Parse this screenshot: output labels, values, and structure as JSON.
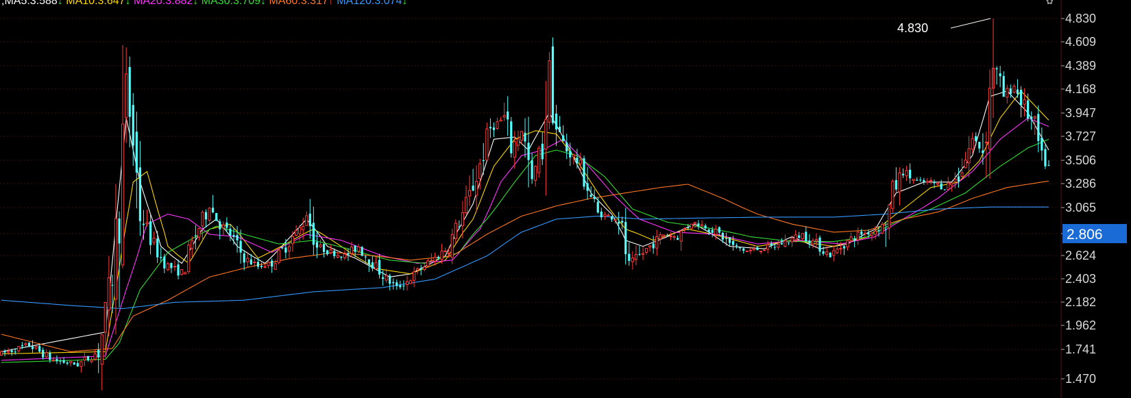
{
  "chart_data": {
    "type": "candlestick",
    "legend": [
      {
        "text": ",MA5:3.588",
        "color": "#ffffff",
        "arrow": "↓"
      },
      {
        "text": "MA10:3.647",
        "color": "#ffd700",
        "arrow": "↓"
      },
      {
        "text": "MA20:3.882",
        "color": "#ff33ff",
        "arrow": "↓"
      },
      {
        "text": "MA30:3.709",
        "color": "#33dd33",
        "arrow": "↓"
      },
      {
        "text": "MA60:3.317",
        "color": "#ff7722",
        "arrow": "↑"
      },
      {
        "text": "MA120:3.074",
        "color": "#3399ff",
        "arrow": "↓"
      }
    ],
    "y_ticks": [
      "4.830",
      "4.609",
      "4.389",
      "4.168",
      "3.947",
      "3.727",
      "3.506",
      "3.286",
      "3.065",
      "2.806",
      "2.624",
      "2.403",
      "2.182",
      "1.962",
      "1.741",
      "1.470"
    ],
    "ylim": [
      1.43,
      4.9
    ],
    "current_price": "2.806",
    "max_label": "4.830",
    "colors": {
      "up": "#ff3b3b",
      "down": "#54ffff",
      "grid": "#3a1010",
      "highlight": "#1a6bd6"
    },
    "anchors": [
      [
        0,
        1.7
      ],
      [
        8,
        1.78
      ],
      [
        15,
        1.64
      ],
      [
        22,
        1.6
      ],
      [
        28,
        1.72
      ],
      [
        31,
        2.2
      ],
      [
        34,
        3.1
      ],
      [
        36,
        4.2
      ],
      [
        38,
        3.7
      ],
      [
        40,
        3.0
      ],
      [
        44,
        2.7
      ],
      [
        47,
        2.55
      ],
      [
        52,
        2.45
      ],
      [
        56,
        2.8
      ],
      [
        60,
        3.08
      ],
      [
        63,
        2.9
      ],
      [
        66,
        2.8
      ],
      [
        70,
        2.6
      ],
      [
        74,
        2.52
      ],
      [
        78,
        2.55
      ],
      [
        82,
        2.7
      ],
      [
        86,
        2.85
      ],
      [
        88,
        3.0
      ],
      [
        91,
        2.7
      ],
      [
        95,
        2.65
      ],
      [
        99,
        2.62
      ],
      [
        103,
        2.7
      ],
      [
        107,
        2.55
      ],
      [
        111,
        2.4
      ],
      [
        114,
        2.32
      ],
      [
        117,
        2.38
      ],
      [
        121,
        2.5
      ],
      [
        125,
        2.6
      ],
      [
        129,
        2.7
      ],
      [
        133,
        3.0
      ],
      [
        137,
        3.35
      ],
      [
        141,
        3.8
      ],
      [
        145,
        3.9
      ],
      [
        147,
        3.6
      ],
      [
        150,
        3.8
      ],
      [
        153,
        3.3
      ],
      [
        156,
        3.65
      ],
      [
        158,
        4.4
      ],
      [
        160,
        3.8
      ],
      [
        163,
        3.6
      ],
      [
        166,
        3.5
      ],
      [
        169,
        3.25
      ],
      [
        172,
        3.0
      ],
      [
        175,
        2.98
      ],
      [
        178,
        2.95
      ],
      [
        181,
        2.52
      ],
      [
        184,
        2.62
      ],
      [
        187,
        2.7
      ],
      [
        191,
        2.8
      ],
      [
        195,
        2.78
      ],
      [
        199,
        2.92
      ],
      [
        203,
        2.88
      ],
      [
        207,
        2.8
      ],
      [
        211,
        2.7
      ],
      [
        215,
        2.66
      ],
      [
        219,
        2.68
      ],
      [
        223,
        2.7
      ],
      [
        227,
        2.75
      ],
      [
        231,
        2.8
      ],
      [
        235,
        2.72
      ],
      [
        239,
        2.62
      ],
      [
        243,
        2.72
      ],
      [
        247,
        2.8
      ],
      [
        251,
        2.82
      ],
      [
        255,
        2.9
      ],
      [
        257,
        3.2
      ],
      [
        260,
        3.4
      ],
      [
        264,
        3.3
      ],
      [
        268,
        3.3
      ],
      [
        272,
        3.25
      ],
      [
        276,
        3.35
      ],
      [
        280,
        3.7
      ],
      [
        283,
        3.6
      ],
      [
        286,
        4.4
      ],
      [
        289,
        4.1
      ],
      [
        292,
        4.2
      ],
      [
        295,
        4.0
      ],
      [
        298,
        3.8
      ],
      [
        300,
        3.5
      ],
      [
        302,
        3.45
      ]
    ],
    "ma": {
      "MA5": [
        [
          0,
          1.72
        ],
        [
          30,
          1.9
        ],
        [
          36,
          3.9
        ],
        [
          40,
          3.3
        ],
        [
          46,
          2.7
        ],
        [
          52,
          2.55
        ],
        [
          58,
          2.85
        ],
        [
          62,
          2.95
        ],
        [
          68,
          2.7
        ],
        [
          76,
          2.55
        ],
        [
          84,
          2.8
        ],
        [
          88,
          2.95
        ],
        [
          94,
          2.7
        ],
        [
          102,
          2.6
        ],
        [
          112,
          2.42
        ],
        [
          118,
          2.45
        ],
        [
          128,
          2.62
        ],
        [
          136,
          3.1
        ],
        [
          142,
          3.7
        ],
        [
          148,
          3.72
        ],
        [
          152,
          3.6
        ],
        [
          158,
          3.95
        ],
        [
          164,
          3.6
        ],
        [
          170,
          3.2
        ],
        [
          176,
          3.0
        ],
        [
          180,
          2.75
        ],
        [
          185,
          2.7
        ],
        [
          192,
          2.78
        ],
        [
          200,
          2.9
        ],
        [
          210,
          2.7
        ],
        [
          220,
          2.68
        ],
        [
          228,
          2.78
        ],
        [
          236,
          2.68
        ],
        [
          244,
          2.72
        ],
        [
          252,
          2.85
        ],
        [
          258,
          3.2
        ],
        [
          266,
          3.3
        ],
        [
          274,
          3.3
        ],
        [
          280,
          3.55
        ],
        [
          285,
          4.1
        ],
        [
          290,
          4.15
        ],
        [
          296,
          3.95
        ],
        [
          302,
          3.6
        ]
      ],
      "MA10": [
        [
          0,
          1.7
        ],
        [
          30,
          1.72
        ],
        [
          38,
          3.3
        ],
        [
          42,
          3.4
        ],
        [
          48,
          2.7
        ],
        [
          54,
          2.55
        ],
        [
          60,
          2.85
        ],
        [
          66,
          2.9
        ],
        [
          74,
          2.6
        ],
        [
          82,
          2.72
        ],
        [
          90,
          2.85
        ],
        [
          98,
          2.7
        ],
        [
          108,
          2.5
        ],
        [
          118,
          2.45
        ],
        [
          128,
          2.58
        ],
        [
          136,
          2.95
        ],
        [
          142,
          3.45
        ],
        [
          148,
          3.7
        ],
        [
          154,
          3.78
        ],
        [
          160,
          3.75
        ],
        [
          166,
          3.5
        ],
        [
          172,
          3.2
        ],
        [
          180,
          2.85
        ],
        [
          188,
          2.75
        ],
        [
          198,
          2.85
        ],
        [
          208,
          2.78
        ],
        [
          218,
          2.7
        ],
        [
          228,
          2.75
        ],
        [
          240,
          2.7
        ],
        [
          250,
          2.78
        ],
        [
          258,
          3.0
        ],
        [
          268,
          3.25
        ],
        [
          276,
          3.3
        ],
        [
          282,
          3.5
        ],
        [
          288,
          3.9
        ],
        [
          294,
          4.15
        ],
        [
          302,
          3.88
        ]
      ],
      "MA20": [
        [
          0,
          1.64
        ],
        [
          30,
          1.68
        ],
        [
          36,
          2.3
        ],
        [
          42,
          2.9
        ],
        [
          48,
          3.0
        ],
        [
          54,
          2.95
        ],
        [
          60,
          2.8
        ],
        [
          68,
          2.78
        ],
        [
          78,
          2.65
        ],
        [
          88,
          2.8
        ],
        [
          98,
          2.75
        ],
        [
          110,
          2.62
        ],
        [
          120,
          2.55
        ],
        [
          130,
          2.58
        ],
        [
          138,
          2.85
        ],
        [
          144,
          3.3
        ],
        [
          150,
          3.55
        ],
        [
          156,
          3.6
        ],
        [
          162,
          3.7
        ],
        [
          168,
          3.5
        ],
        [
          176,
          3.2
        ],
        [
          184,
          2.95
        ],
        [
          194,
          2.82
        ],
        [
          206,
          2.8
        ],
        [
          218,
          2.72
        ],
        [
          230,
          2.75
        ],
        [
          242,
          2.72
        ],
        [
          252,
          2.78
        ],
        [
          260,
          2.95
        ],
        [
          270,
          3.15
        ],
        [
          280,
          3.4
        ],
        [
          288,
          3.7
        ],
        [
          296,
          3.9
        ],
        [
          302,
          3.82
        ]
      ],
      "MA30": [
        [
          0,
          1.62
        ],
        [
          30,
          1.65
        ],
        [
          34,
          1.8
        ],
        [
          40,
          2.3
        ],
        [
          48,
          2.65
        ],
        [
          56,
          2.78
        ],
        [
          62,
          2.88
        ],
        [
          70,
          2.8
        ],
        [
          80,
          2.72
        ],
        [
          90,
          2.75
        ],
        [
          100,
          2.68
        ],
        [
          112,
          2.58
        ],
        [
          122,
          2.55
        ],
        [
          132,
          2.65
        ],
        [
          140,
          2.95
        ],
        [
          148,
          3.3
        ],
        [
          154,
          3.55
        ],
        [
          160,
          3.6
        ],
        [
          166,
          3.55
        ],
        [
          174,
          3.35
        ],
        [
          182,
          3.05
        ],
        [
          192,
          2.92
        ],
        [
          204,
          2.86
        ],
        [
          216,
          2.78
        ],
        [
          228,
          2.74
        ],
        [
          240,
          2.74
        ],
        [
          250,
          2.78
        ],
        [
          258,
          2.92
        ],
        [
          268,
          3.05
        ],
        [
          278,
          3.2
        ],
        [
          288,
          3.45
        ],
        [
          296,
          3.62
        ],
        [
          302,
          3.7
        ]
      ],
      "MA60": [
        [
          0,
          1.88
        ],
        [
          20,
          1.72
        ],
        [
          32,
          1.75
        ],
        [
          38,
          2.05
        ],
        [
          48,
          2.2
        ],
        [
          60,
          2.42
        ],
        [
          72,
          2.52
        ],
        [
          84,
          2.6
        ],
        [
          96,
          2.65
        ],
        [
          108,
          2.62
        ],
        [
          118,
          2.58
        ],
        [
          130,
          2.62
        ],
        [
          140,
          2.8
        ],
        [
          150,
          2.98
        ],
        [
          160,
          3.08
        ],
        [
          170,
          3.15
        ],
        [
          180,
          3.2
        ],
        [
          190,
          3.25
        ],
        [
          198,
          3.28
        ],
        [
          208,
          3.15
        ],
        [
          218,
          3.0
        ],
        [
          228,
          2.9
        ],
        [
          240,
          2.82
        ],
        [
          250,
          2.84
        ],
        [
          260,
          2.95
        ],
        [
          270,
          3.02
        ],
        [
          280,
          3.15
        ],
        [
          290,
          3.25
        ],
        [
          302,
          3.31
        ]
      ],
      "MA120": [
        [
          0,
          2.2
        ],
        [
          20,
          2.15
        ],
        [
          35,
          2.12
        ],
        [
          50,
          2.18
        ],
        [
          70,
          2.2
        ],
        [
          90,
          2.28
        ],
        [
          110,
          2.32
        ],
        [
          125,
          2.4
        ],
        [
          140,
          2.62
        ],
        [
          150,
          2.82
        ],
        [
          160,
          2.95
        ],
        [
          172,
          2.98
        ],
        [
          185,
          2.95
        ],
        [
          200,
          2.96
        ],
        [
          220,
          2.97
        ],
        [
          240,
          2.97
        ],
        [
          255,
          3.0
        ],
        [
          270,
          3.05
        ],
        [
          285,
          3.07
        ],
        [
          302,
          3.07
        ]
      ]
    }
  }
}
